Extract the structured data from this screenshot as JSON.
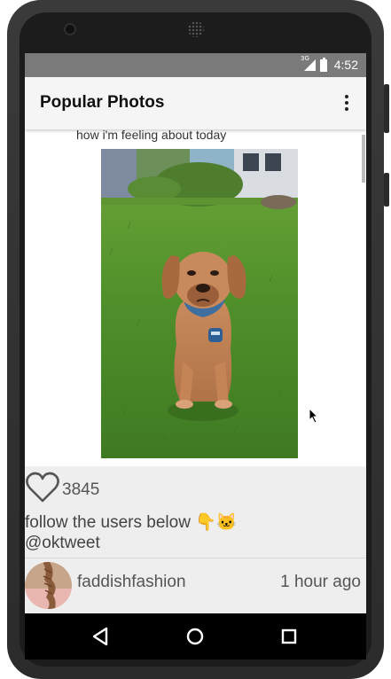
{
  "status_bar": {
    "time": "4:52",
    "network": "3G"
  },
  "app_bar": {
    "title": "Popular Photos"
  },
  "post": {
    "caption": "how i'm feeling about today",
    "likes": "3845",
    "description_line1": "follow the users below",
    "description_emojis": "👇🐱",
    "description_line2": "@oktweet",
    "username": "faddishfashion",
    "time_ago": "1 hour ago"
  },
  "icons": {
    "overflow": "more-vert-icon",
    "like": "heart-outline-icon",
    "back": "back-triangle-icon",
    "home": "home-circle-icon",
    "recents": "recents-square-icon"
  },
  "colors": {
    "app_bar": "#f5f5f5",
    "meta_bg": "#eeeeee",
    "status_bar": "#7a7a7a",
    "nav_bar": "#000000"
  }
}
